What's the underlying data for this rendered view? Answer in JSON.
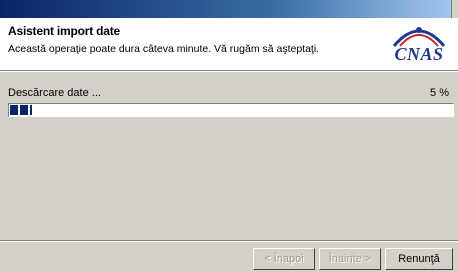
{
  "header": {
    "title": "Asistent import date",
    "subtitle": "Această operaţie poate dura câteva minute. Vă rugăm să aşteptaţi.",
    "logo_text": "CNAS"
  },
  "progress": {
    "label": "Descărcare date ...",
    "percent_text": "5 %",
    "value": 0.05,
    "fill_color": "#0a246a"
  },
  "buttons": {
    "back": "< Înapoi",
    "next": "Înainte >",
    "cancel": "Renunţă"
  },
  "colors": {
    "titlebar": "#0a246a",
    "dialog_bg": "#d4d0c8",
    "logo": "#1f3a8a",
    "logo_accent": "#c0282d"
  }
}
